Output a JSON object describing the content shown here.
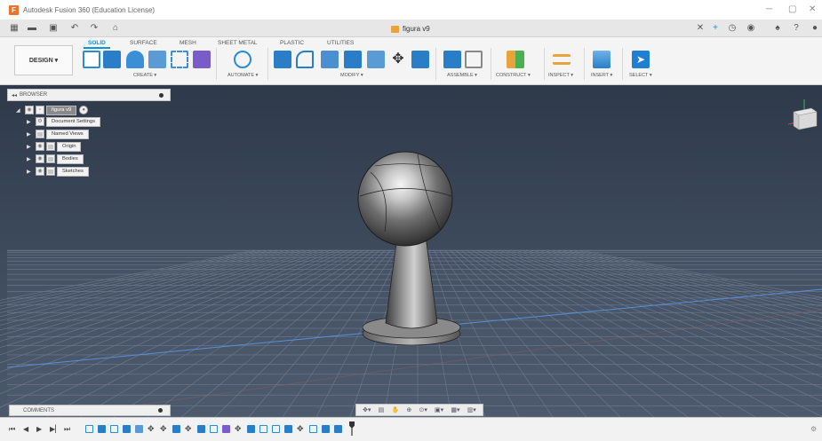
{
  "window": {
    "title": "Autodesk Fusion 360 (Education License)"
  },
  "quick_access": {
    "document_tab": "figura v9"
  },
  "ribbon": {
    "workspace_button": "DESIGN ▾",
    "tabs": [
      "SOLID",
      "SURFACE",
      "MESH",
      "SHEET METAL",
      "PLASTIC",
      "UTILITIES"
    ],
    "active_tab": "SOLID",
    "groups": [
      "CREATE ▾",
      "AUTOMATE ▾",
      "MODIFY ▾",
      "ASSEMBLE ▾",
      "CONSTRUCT ▾",
      "INSPECT ▾",
      "INSERT ▾",
      "SELECT ▾"
    ]
  },
  "browser": {
    "header": "BROWSER",
    "root": "figura v9",
    "items": [
      "Document Settings",
      "Named Views",
      "Origin",
      "Bodies",
      "Sketches"
    ]
  },
  "comments": {
    "label": "COMMENTS"
  },
  "colors": {
    "accent": "#0696d7",
    "viewport_top": "#2e3a4a",
    "viewport_bottom": "#4a586b",
    "grid_line": "#6d7b8d",
    "app_logo": "#e8752b"
  },
  "icons": {
    "navbar": [
      "orbit-icon",
      "look-at-icon",
      "pan-icon",
      "zoom-fit-icon",
      "zoom-icon",
      "display-settings-icon",
      "grid-settings-icon",
      "viewports-icon"
    ],
    "timeline_controls": [
      "go-to-start-icon",
      "step-back-icon",
      "play-icon",
      "step-forward-icon",
      "go-to-end-icon"
    ]
  }
}
